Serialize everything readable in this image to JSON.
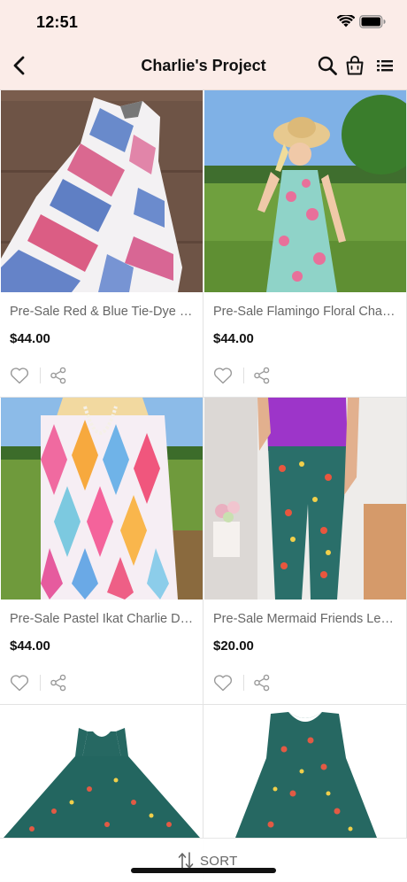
{
  "status_bar": {
    "time": "12:51"
  },
  "header": {
    "title": "Charlie's Project"
  },
  "products": [
    {
      "name": "Pre-Sale Red & Blue Tie-Dye Charlie Dress",
      "price": "$44.00"
    },
    {
      "name": "Pre-Sale Flamingo Floral Charlie Dress",
      "price": "$44.00"
    },
    {
      "name": "Pre-Sale Pastel Ikat Charlie Dress",
      "price": "$44.00"
    },
    {
      "name": "Pre-Sale Mermaid Friends Leggings",
      "price": "$20.00"
    },
    {
      "name": "",
      "price": ""
    },
    {
      "name": "",
      "price": ""
    }
  ],
  "sort": {
    "label": "SORT"
  },
  "colors": {
    "header_bg": "#fbece8",
    "text": "#111111",
    "muted": "#666666"
  },
  "icons": [
    "back-chevron-icon",
    "search-icon",
    "shopping-bag-icon",
    "list-menu-icon",
    "heart-icon",
    "share-icon",
    "sort-arrows-icon"
  ]
}
